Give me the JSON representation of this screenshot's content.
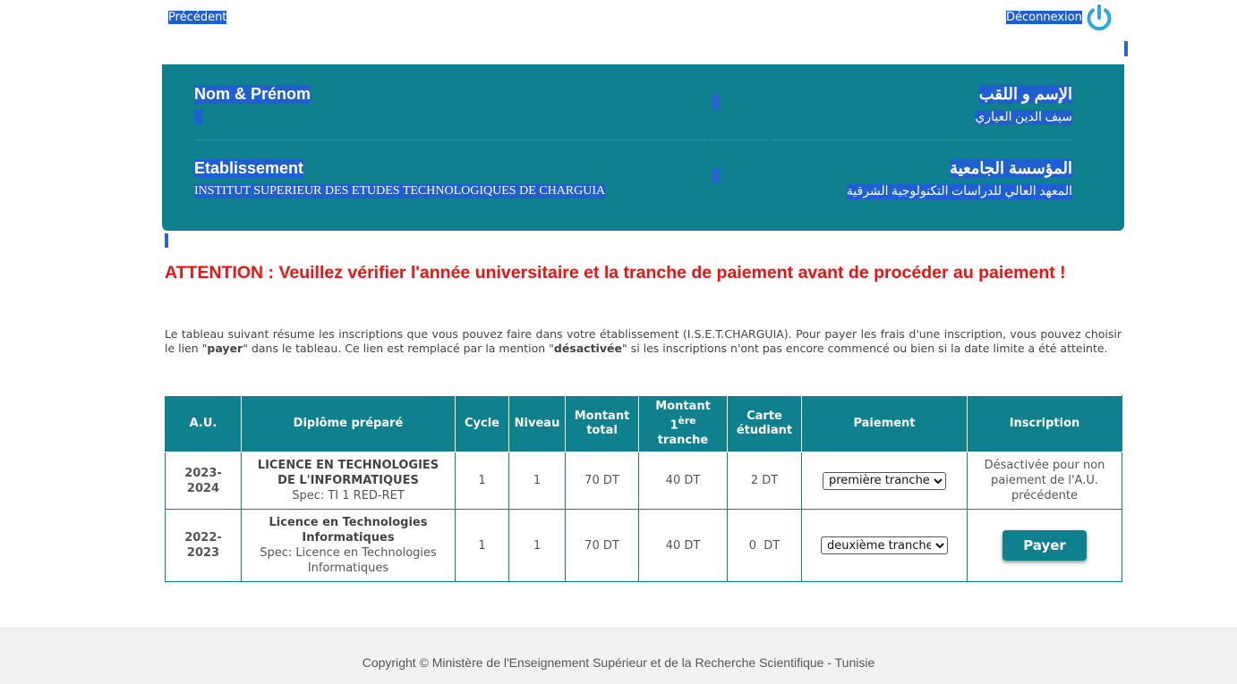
{
  "nav": {
    "previous_label": "Précédent",
    "logout_label": "Déconnexion"
  },
  "profile": {
    "name_label_fr": "Nom & Prénom",
    "name_label_ar": "الإسم و اللقب",
    "name_value_ar": "سيف الدين العياري",
    "name_value_fr": "",
    "etab_label_fr": "Etablissement",
    "etab_label_ar": "المؤسسة الجامعية",
    "etab_value_fr": "INSTITUT SUPERIEUR DES ETUDES TECHNOLOGIQUES DE CHARGUIA",
    "etab_value_ar": "المعهد العالي للدراسات التكنولوجية الشرقية"
  },
  "warning": "ATTENTION : Veuillez vérifier l'année universitaire et la tranche de paiement avant de procéder au paiement !",
  "intro": {
    "part1": "Le tableau suivant résume les inscriptions que vous pouvez faire dans votre établissement (I.S.E.T.CHARGUIA). Pour payer les frais d'une inscription, vous pouvez choisir le lien \"",
    "pay_word": "payer",
    "part2": "\" dans le tableau. Ce lien est remplacé par la mention \"",
    "disabled_word": "désactivée",
    "part3": "\" si les inscriptions n'ont pas encore commencé ou bien si la date limite a été atteinte."
  },
  "table": {
    "headers": {
      "au": "A.U.",
      "diplome": "Diplôme préparé",
      "cycle": "Cycle",
      "niveau": "Niveau",
      "montant_total": "Montant total",
      "montant_1_pre": "Montant 1",
      "montant_1_sup": "ère",
      "montant_1_post": "tranche",
      "carte": "Carte étudiant",
      "paiement": "Paiement",
      "inscription": "Inscription"
    },
    "rows": [
      {
        "au": "2023-2024",
        "diplome": "LICENCE EN TECHNOLOGIES DE L'INFORMATIQUES",
        "spec": "Spec: TI 1 RED-RET",
        "cycle": "1",
        "niveau": "1",
        "montant_total": "70 DT",
        "montant_1": "40 DT",
        "carte": "2 DT",
        "paiement_selected": "première tranche",
        "inscription_text": "Désactivée pour non paiement de l'A.U. précédente"
      },
      {
        "au": "2022-2023",
        "diplome": "Licence en Technologies Informatiques",
        "spec": "Spec: Licence en Technologies Informatiques",
        "cycle": "1",
        "niveau": "1",
        "montant_total": "70 DT",
        "montant_1": "40 DT",
        "carte": "0  DT",
        "paiement_selected": "deuxième tranche",
        "inscription_button": "Payer"
      }
    ]
  },
  "footer": {
    "copyright": "Copyright © Ministère de l'Enseignement Supérieur et de la Recherche Scientifique - Tunisie"
  },
  "colors": {
    "teal": "#0f818e",
    "warning_red": "#ee1111",
    "selection_blue": "#1f5fd1"
  },
  "icons": {
    "logout": "power-icon"
  }
}
